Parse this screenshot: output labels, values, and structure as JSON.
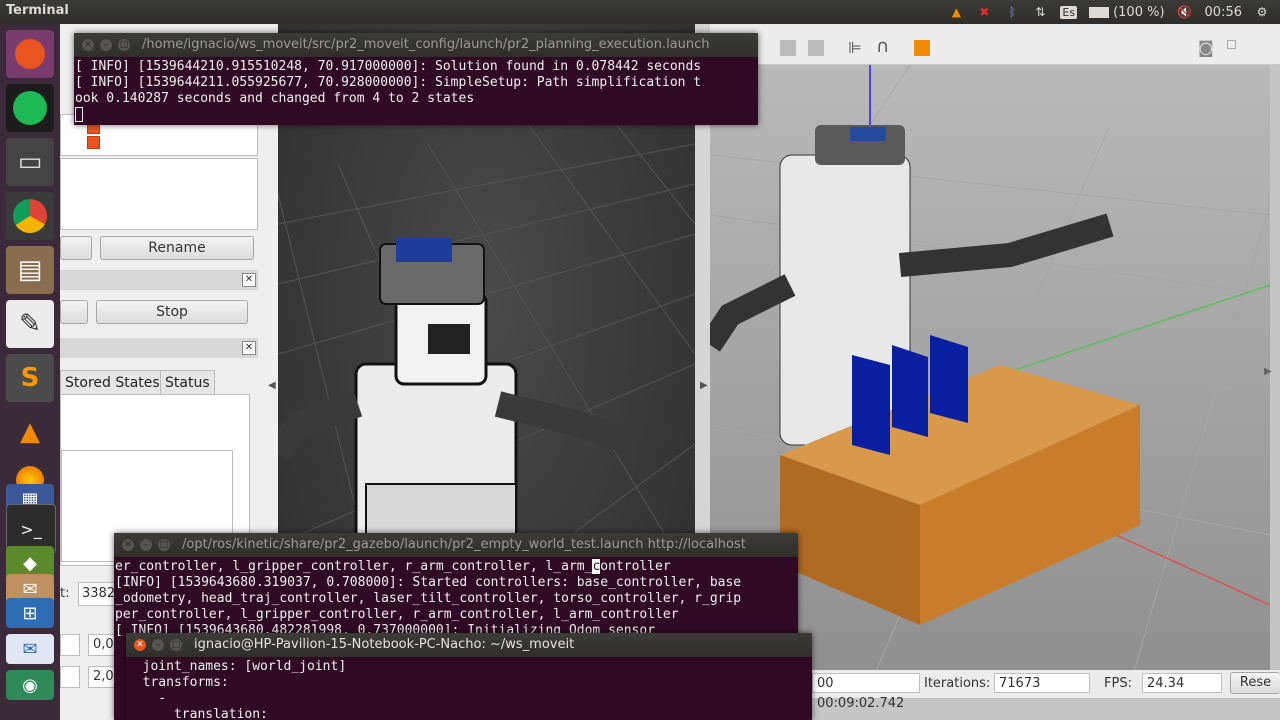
{
  "topbar": {
    "app_name": "Terminal",
    "keyboard_layout": "Es",
    "battery": "(100 %)",
    "time": "00:56"
  },
  "launcher": {
    "icons": [
      "ubuntu-icon",
      "spotify-icon",
      "scanner-icon",
      "chrome-icon",
      "file-manager-icon",
      "text-editor-icon",
      "sublime-icon",
      "vlc-icon",
      "firefox-icon",
      "document-icon",
      "terminal-icon",
      "settings-icon",
      "files-icon",
      "calculator-icon",
      "mail-icon",
      "app-icon"
    ]
  },
  "rviz": {
    "rename_label": "Rename",
    "stop_label": "Stop",
    "tabs": [
      "Stored States",
      "Status"
    ],
    "field_label": "t:",
    "field_value": "3382",
    "coord1": "0,0",
    "coord2": "2,0"
  },
  "gazebo": {
    "sim_time": "00 00:09:02.742",
    "iterations_label": "Iterations:",
    "iterations_value": "71673",
    "fps_label": "FPS:",
    "fps_value": "24.34",
    "reset_label": "Rese"
  },
  "term1": {
    "title": "/home/ignacio/ws_moveit/src/pr2_moveit_config/launch/pr2_planning_execution.launch",
    "lines": [
      "[ INFO] [1539644210.915510248, 70.917000000]: Solution found in 0.078442 seconds",
      "[ INFO] [1539644211.055925677, 70.928000000]: SimpleSetup: Path simplification t",
      "ook 0.140287 seconds and changed from 4 to 2 states"
    ]
  },
  "term2": {
    "title": "/opt/ros/kinetic/share/pr2_gazebo/launch/pr2_empty_world_test.launch http://localhost",
    "line0_before": "er_controller, l_gripper_controller, r_arm_controller, l_arm_",
    "line0_cursor": "c",
    "line0_after": "ontroller",
    "lines": [
      "[INFO] [1539643680.319037, 0.708000]: Started controllers: base_controller, base",
      "_odometry, head_traj_controller, laser_tilt_controller, torso_controller, r_grip",
      "per_controller, l_gripper_controller, r_arm_controller, l_arm_controller",
      "[ INFO] [1539643680.482281998, 0.737000000]: Initializing Odom sensor"
    ]
  },
  "term3": {
    "title": "ignacio@HP-Pavilion-15-Notebook-PC-Nacho: ~/ws_moveit",
    "lines": [
      "  joint_names: [world_joint]",
      "  transforms:",
      "    -",
      "      translation:"
    ]
  }
}
